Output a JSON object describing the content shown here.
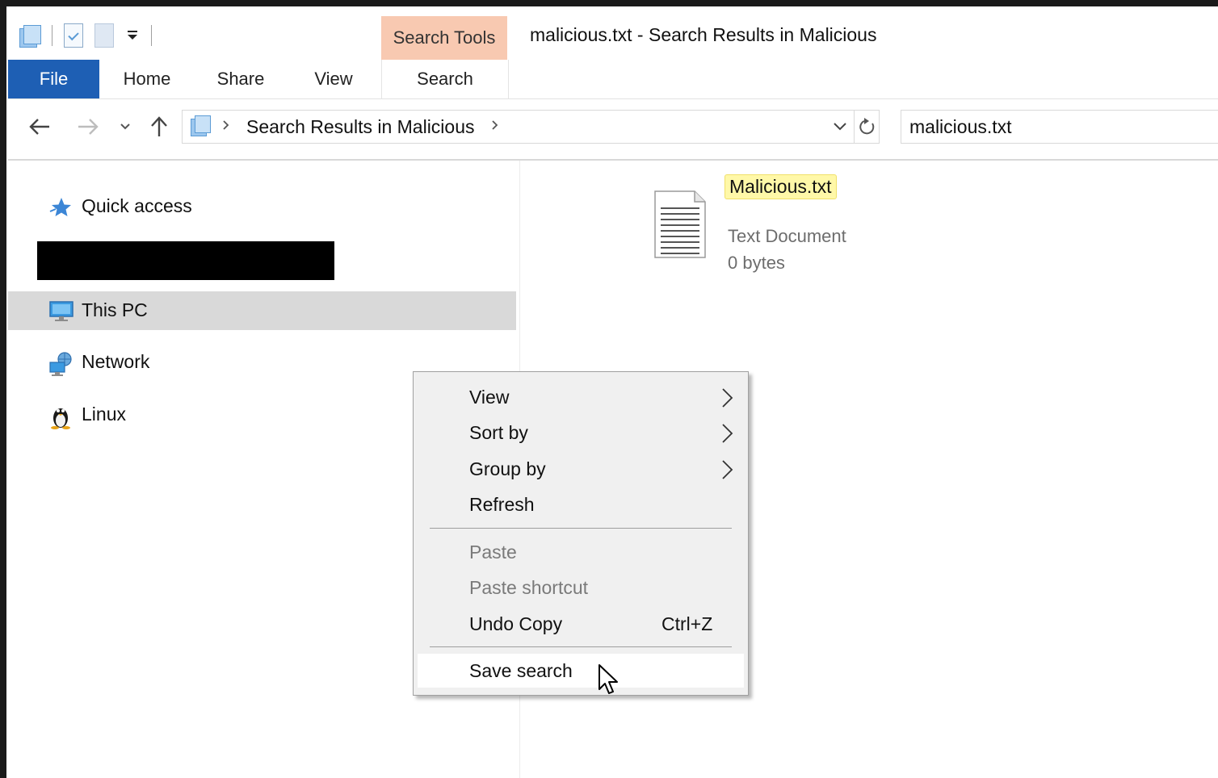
{
  "window": {
    "title": "malicious.txt - Search Results in Malicious",
    "contextual_tab_group": "Search Tools"
  },
  "ribbon": {
    "tabs": [
      "File",
      "Home",
      "Share",
      "View",
      "Search"
    ]
  },
  "address_bar": {
    "breadcrumb": "Search Results in Malicious"
  },
  "search": {
    "value": "malicious.txt"
  },
  "nav_pane": {
    "items": [
      {
        "label": "Quick access",
        "icon": "star-icon"
      },
      {
        "label": "This PC",
        "icon": "computer-icon",
        "selected": true
      },
      {
        "label": "Network",
        "icon": "network-icon"
      },
      {
        "label": "Linux",
        "icon": "linux-penguin-icon"
      }
    ]
  },
  "results": {
    "item": {
      "name": "Malicious.txt",
      "type": "Text Document",
      "size": "0 bytes",
      "icon": "text-document-icon"
    }
  },
  "context_menu": {
    "items": [
      {
        "label": "View",
        "submenu": true
      },
      {
        "label": "Sort by",
        "submenu": true
      },
      {
        "label": "Group by",
        "submenu": true
      },
      {
        "label": "Refresh"
      },
      {
        "label": "Paste",
        "disabled": true
      },
      {
        "label": "Paste shortcut",
        "disabled": true
      },
      {
        "label": "Undo Copy",
        "shortcut": "Ctrl+Z"
      },
      {
        "label": "Save search",
        "hovered": true
      }
    ]
  },
  "colors": {
    "file_tab": "#1e5fb4",
    "search_tools": "#f8c9b1",
    "highlight": "#fff8a8",
    "selection": "#d9d9d9",
    "menu_bg": "#f0f0f0"
  }
}
